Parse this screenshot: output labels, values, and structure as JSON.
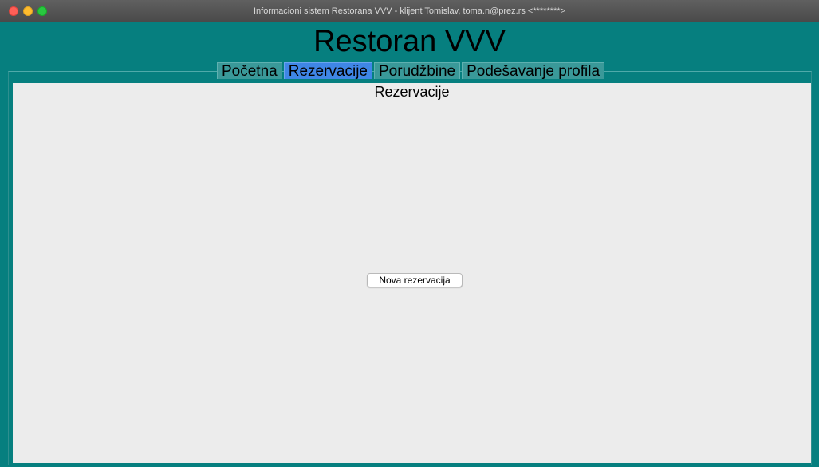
{
  "window": {
    "title": "Informacioni sistem Restorana VVV - klijent Tomislav, toma.n@prez.rs <********>"
  },
  "app": {
    "title": "Restoran VVV"
  },
  "tabs": [
    {
      "label": "Početna",
      "active": false
    },
    {
      "label": "Rezervacije",
      "active": true
    },
    {
      "label": "Porudžbine",
      "active": false
    },
    {
      "label": "Podešavanje profila",
      "active": false
    }
  ],
  "content": {
    "title": "Rezervacije",
    "new_reservation_label": "Nova rezervacija"
  },
  "colors": {
    "window_background": "#067f7f",
    "active_tab": "#3f86e6",
    "panel_background": "#ececec"
  },
  "icons": {
    "close": "close-icon",
    "minimize": "minimize-icon",
    "maximize": "maximize-icon"
  }
}
